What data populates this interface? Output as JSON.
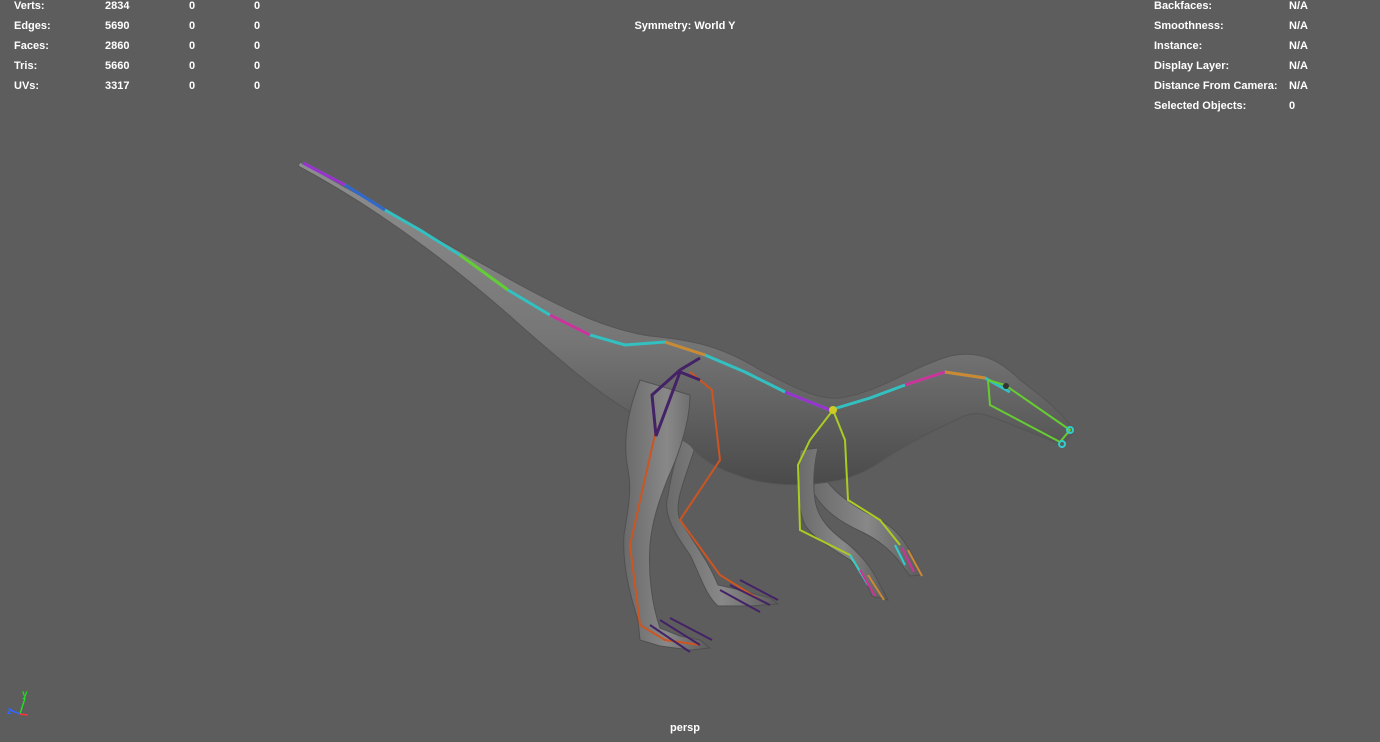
{
  "poly_count": {
    "rows": [
      {
        "label": "Verts:",
        "values": [
          "2834",
          "0",
          "0"
        ]
      },
      {
        "label": "Edges:",
        "values": [
          "5690",
          "0",
          "0"
        ]
      },
      {
        "label": "Faces:",
        "values": [
          "2860",
          "0",
          "0"
        ]
      },
      {
        "label": "Tris:",
        "values": [
          "5660",
          "0",
          "0"
        ]
      },
      {
        "label": "UVs:",
        "values": [
          "3317",
          "0",
          "0"
        ]
      }
    ]
  },
  "symmetry_label": "Symmetry: World Y",
  "object_info": {
    "rows": [
      {
        "label": "Backfaces:",
        "value": "N/A"
      },
      {
        "label": "Smoothness:",
        "value": "N/A"
      },
      {
        "label": "Instance:",
        "value": "N/A"
      },
      {
        "label": "Display Layer:",
        "value": "N/A"
      },
      {
        "label": "Distance From Camera:",
        "value": "N/A"
      },
      {
        "label": "Selected Objects:",
        "value": "0"
      }
    ]
  },
  "camera_name": "persp",
  "axis_gizmo": {
    "y_label": "y",
    "z_label": "z",
    "y_color": "#22dd22",
    "z_color": "#3366ff",
    "x_color": "#ff3333"
  },
  "colors": {
    "background": "#5d5d5d",
    "mesh": "#7a7a7a",
    "hud_text": "#ffffff"
  }
}
